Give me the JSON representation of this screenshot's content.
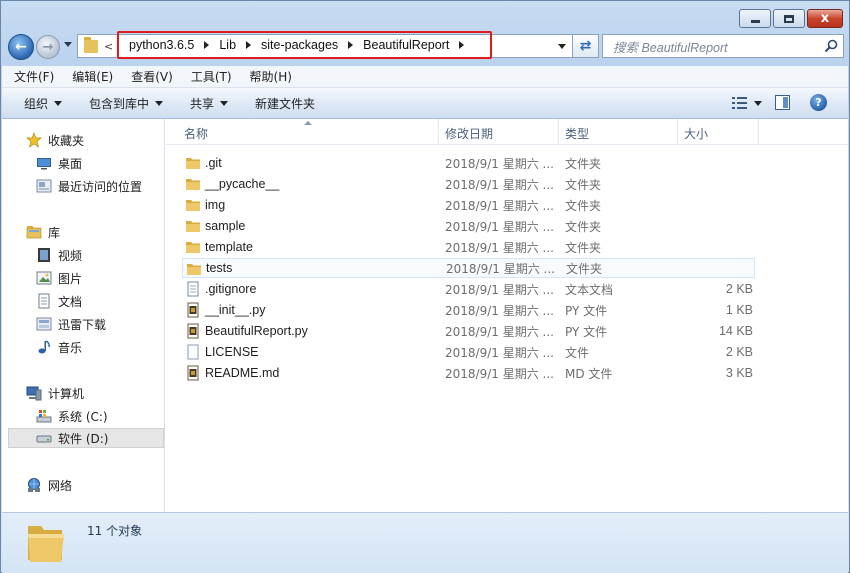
{
  "address": {
    "lt_glyph": "<",
    "crumbs": [
      "python3.6.5",
      "Lib",
      "site-packages",
      "BeautifulReport"
    ]
  },
  "search": {
    "placeholder": "搜索 BeautifulReport"
  },
  "caption": {
    "minimize": "–",
    "maximize": "□",
    "close": "x"
  },
  "menu": {
    "items": [
      "文件(F)",
      "编辑(E)",
      "查看(V)",
      "工具(T)",
      "帮助(H)"
    ]
  },
  "commands": {
    "organize": "组织",
    "include_in_library": "包含到库中",
    "share": "共享",
    "new_folder": "新建文件夹"
  },
  "nav": {
    "favorites": "收藏夹",
    "desktop": "桌面",
    "recent": "最近访问的位置",
    "libraries": "库",
    "videos": "视频",
    "pictures": "图片",
    "documents": "文档",
    "xunlei": "迅雷下载",
    "music": "音乐",
    "computer": "计算机",
    "drive_c": "系统 (C:)",
    "drive_d": "软件 (D:)",
    "network": "网络"
  },
  "columns": {
    "name": "名称",
    "date": "修改日期",
    "type": "类型",
    "size": "大小"
  },
  "files": [
    {
      "name": ".git",
      "date": "2018/9/1 星期六 ...",
      "type": "文件夹",
      "size": "",
      "kind": "folder"
    },
    {
      "name": "__pycache__",
      "date": "2018/9/1 星期六 ...",
      "type": "文件夹",
      "size": "",
      "kind": "folder"
    },
    {
      "name": "img",
      "date": "2018/9/1 星期六 ...",
      "type": "文件夹",
      "size": "",
      "kind": "folder"
    },
    {
      "name": "sample",
      "date": "2018/9/1 星期六 ...",
      "type": "文件夹",
      "size": "",
      "kind": "folder"
    },
    {
      "name": "template",
      "date": "2018/9/1 星期六 ...",
      "type": "文件夹",
      "size": "",
      "kind": "folder"
    },
    {
      "name": "tests",
      "date": "2018/9/1 星期六 ...",
      "type": "文件夹",
      "size": "",
      "kind": "folder"
    },
    {
      "name": ".gitignore",
      "date": "2018/9/1 星期六 ...",
      "type": "文本文档",
      "size": "2 KB",
      "kind": "text"
    },
    {
      "name": "__init__.py",
      "date": "2018/9/1 星期六 ...",
      "type": "PY 文件",
      "size": "1 KB",
      "kind": "py"
    },
    {
      "name": "BeautifulReport.py",
      "date": "2018/9/1 星期六 ...",
      "type": "PY 文件",
      "size": "14 KB",
      "kind": "py"
    },
    {
      "name": "LICENSE",
      "date": "2018/9/1 星期六 ...",
      "type": "文件",
      "size": "2 KB",
      "kind": "file"
    },
    {
      "name": "README.md",
      "date": "2018/9/1 星期六 ...",
      "type": "MD 文件",
      "size": "3 KB",
      "kind": "py"
    }
  ],
  "status": {
    "count_text": "11 个对象"
  },
  "colors": {
    "highlight_box": "#e01b1b",
    "folder": "#e7c15b"
  }
}
